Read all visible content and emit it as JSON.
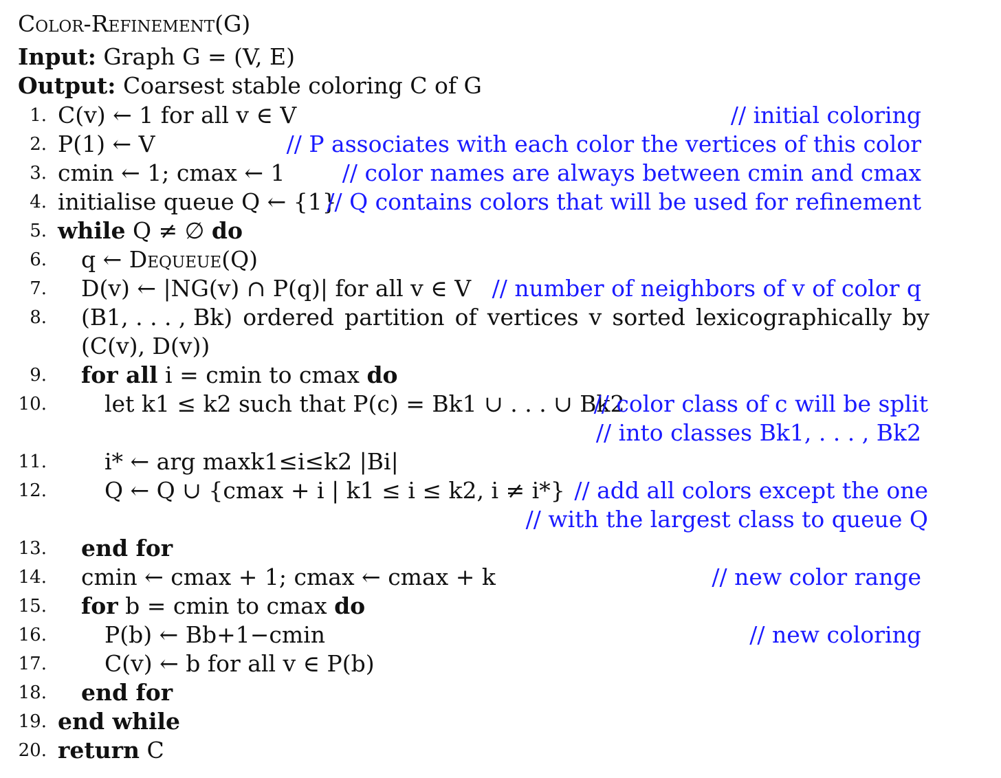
{
  "header": {
    "title": "Color-Refinement(G)",
    "input_label": "Input:",
    "input_text": "Graph G = (V, E)",
    "output_label": "Output:",
    "output_text": "Coarsest stable coloring C of G"
  },
  "lines": [
    {
      "num": "1.",
      "code": "C(v) ← 1 for all v ∈ V",
      "comment": "// initial coloring"
    },
    {
      "num": "2.",
      "code": "P(1) ← V",
      "comment": "// P associates with each color the vertices of this color"
    },
    {
      "num": "3.",
      "code": "cmin ← 1; cmax ← 1",
      "comment": "// color names are always between cmin and cmax"
    },
    {
      "num": "4.",
      "code": "initialise queue Q ← {1}",
      "comment": "// Q contains colors that will be used for refinement"
    },
    {
      "num": "5.",
      "kw1": "while",
      "code": "Q ≠ ∅",
      "kw2": "do"
    },
    {
      "num": "6.",
      "code_pre": "q ← ",
      "code_sc": "Dequeue",
      "code_post": "(Q)"
    },
    {
      "num": "7.",
      "code": "D(v) ← |NG(v) ∩ P(q)| for all v ∈ V",
      "comment": "// number of neighbors of v of color q"
    },
    {
      "num": "8.",
      "words": [
        "(B1, . . . , Bk)",
        "ordered",
        "partition",
        "of",
        "vertices",
        "v",
        "sorted",
        "lexicographically",
        "by"
      ],
      "cont": "(C(v), D(v))"
    },
    {
      "num": "9.",
      "kw1": "for all",
      "code": "i = cmin to cmax",
      "kw2": "do"
    },
    {
      "num": "10.",
      "code": "let k1 ≤ k2 such that P(c) = Bk1 ∪ . . . ∪ Bk2",
      "comment": "// color class of c will be split",
      "comment2": "// into classes Bk1, . . . , Bk2"
    },
    {
      "num": "11.",
      "code": "i* ← arg maxk1≤i≤k2 |Bi|"
    },
    {
      "num": "12.",
      "code": "Q ← Q ∪ {cmax + i | k1 ≤ i ≤ k2, i ≠ i*}",
      "comment": "// add all colors except the one",
      "comment2": "// with the largest class to queue Q"
    },
    {
      "num": "13.",
      "kw1": "end for"
    },
    {
      "num": "14.",
      "code": "cmin ← cmax + 1; cmax ← cmax + k",
      "comment": "// new color range"
    },
    {
      "num": "15.",
      "kw1": "for",
      "code": "b = cmin to cmax",
      "kw2": "do"
    },
    {
      "num": "16.",
      "code": "P(b) ← Bb+1−cmin",
      "comment": "// new coloring"
    },
    {
      "num": "17.",
      "code": "C(v) ← b for all v ∈ P(b)"
    },
    {
      "num": "18.",
      "kw1": "end for"
    },
    {
      "num": "19.",
      "kw1": "end while"
    },
    {
      "num": "20.",
      "kw1": "return",
      "code": "C"
    }
  ],
  "colors": {
    "text": "#111111",
    "comment": "#1a1aff"
  }
}
